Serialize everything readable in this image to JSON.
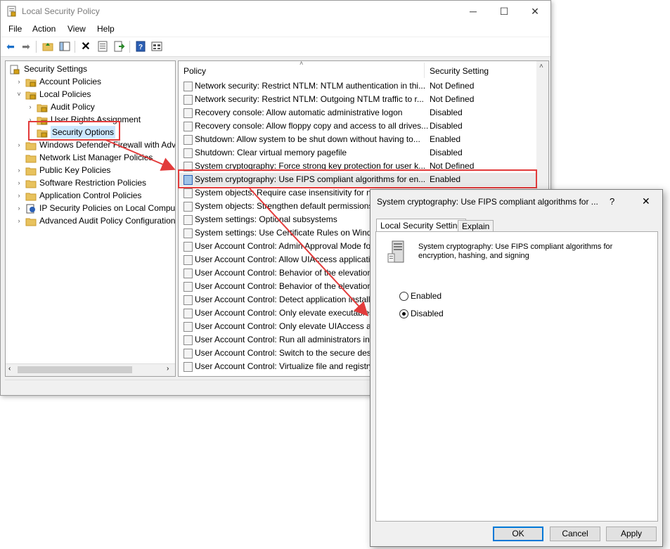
{
  "main_window": {
    "title": "Local Security Policy",
    "controls": {
      "minimize": "─",
      "maximize": "☐",
      "close": "✕"
    },
    "menu": [
      "File",
      "Action",
      "View",
      "Help"
    ],
    "toolbar_icons": [
      "back-icon",
      "forward-icon",
      "up-folder-icon",
      "show-hide-tree-icon",
      "delete-icon",
      "properties-icon",
      "export-icon",
      "help-icon",
      "view-icon"
    ]
  },
  "tree": {
    "items": [
      {
        "label": "Security Settings",
        "level": 0,
        "expander": "",
        "icon": "security-settings-icon"
      },
      {
        "label": "Account Policies",
        "level": 1,
        "expander": "›",
        "icon": "folder-lock-icon"
      },
      {
        "label": "Local Policies",
        "level": 1,
        "expander": "˅",
        "icon": "folder-lock-icon"
      },
      {
        "label": "Audit Policy",
        "level": 2,
        "expander": "›",
        "icon": "folder-lock-icon"
      },
      {
        "label": "User Rights Assignment",
        "level": 2,
        "expander": "›",
        "icon": "folder-lock-icon"
      },
      {
        "label": "Security Options",
        "level": 2,
        "expander": "",
        "icon": "folder-lock-icon",
        "selected": true
      },
      {
        "label": "Windows Defender Firewall with Adva",
        "level": 1,
        "expander": "›",
        "icon": "folder-icon"
      },
      {
        "label": "Network List Manager Policies",
        "level": 1,
        "expander": "",
        "icon": "folder-icon"
      },
      {
        "label": "Public Key Policies",
        "level": 1,
        "expander": "›",
        "icon": "folder-icon"
      },
      {
        "label": "Software Restriction Policies",
        "level": 1,
        "expander": "›",
        "icon": "folder-icon"
      },
      {
        "label": "Application Control Policies",
        "level": 1,
        "expander": "›",
        "icon": "folder-icon"
      },
      {
        "label": "IP Security Policies on Local Compute",
        "level": 1,
        "expander": "›",
        "icon": "ip-security-icon"
      },
      {
        "label": "Advanced Audit Policy Configuration",
        "level": 1,
        "expander": "›",
        "icon": "folder-icon"
      }
    ]
  },
  "list": {
    "columns": {
      "policy": "Policy",
      "setting": "Security Setting"
    },
    "rows": [
      {
        "policy": "Network security: Restrict NTLM: NTLM authentication in thi...",
        "setting": "Not Defined"
      },
      {
        "policy": "Network security: Restrict NTLM: Outgoing NTLM traffic to r...",
        "setting": "Not Defined"
      },
      {
        "policy": "Recovery console: Allow automatic administrative logon",
        "setting": "Disabled"
      },
      {
        "policy": "Recovery console: Allow floppy copy and access to all drives...",
        "setting": "Disabled"
      },
      {
        "policy": "Shutdown: Allow system to be shut down without having to...",
        "setting": "Enabled"
      },
      {
        "policy": "Shutdown: Clear virtual memory pagefile",
        "setting": "Disabled"
      },
      {
        "policy": "System cryptography: Force strong key protection for user k...",
        "setting": "Not Defined"
      },
      {
        "policy": "System cryptography: Use FIPS compliant algorithms for en...",
        "setting": "Enabled",
        "selected": true
      },
      {
        "policy": "System objects: Require case insensitivity for non-Windo...",
        "setting": ""
      },
      {
        "policy": "System objects: Strengthen default permissions of int...",
        "setting": ""
      },
      {
        "policy": "System settings: Optional subsystems",
        "setting": ""
      },
      {
        "policy": "System settings: Use Certificate Rules on Windows Exe...",
        "setting": ""
      },
      {
        "policy": "User Account Control: Admin Approval Mode for the...",
        "setting": ""
      },
      {
        "policy": "User Account Control: Allow UIAccess applications to...",
        "setting": ""
      },
      {
        "policy": "User Account Control: Behavior of the elevation pro...",
        "setting": ""
      },
      {
        "policy": "User Account Control: Behavior of the elevation pro...",
        "setting": ""
      },
      {
        "policy": "User Account Control: Detect application installatio...",
        "setting": ""
      },
      {
        "policy": "User Account Control: Only elevate executables that...",
        "setting": ""
      },
      {
        "policy": "User Account Control: Only elevate UIAccess applic...",
        "setting": ""
      },
      {
        "policy": "User Account Control: Run all administrators in Adm...",
        "setting": ""
      },
      {
        "policy": "User Account Control: Switch to the secure desktop...",
        "setting": ""
      },
      {
        "policy": "User Account Control: Virtualize file and registry wri...",
        "setting": ""
      }
    ]
  },
  "dialog": {
    "title": "System cryptography: Use FIPS compliant algorithms for ...",
    "help": "?",
    "close": "✕",
    "tabs": [
      "Local Security Setting",
      "Explain"
    ],
    "description_line1": "System cryptography: Use FIPS compliant algorithms for",
    "description_line2": "encryption, hashing, and signing",
    "options": [
      {
        "label": "Enabled",
        "checked": false
      },
      {
        "label": "Disabled",
        "checked": true
      }
    ],
    "buttons": {
      "ok": "OK",
      "cancel": "Cancel",
      "apply": "Apply"
    }
  },
  "colors": {
    "highlight": "#e23b3b",
    "selection": "#cce8ff",
    "accent": "#0078d7"
  }
}
